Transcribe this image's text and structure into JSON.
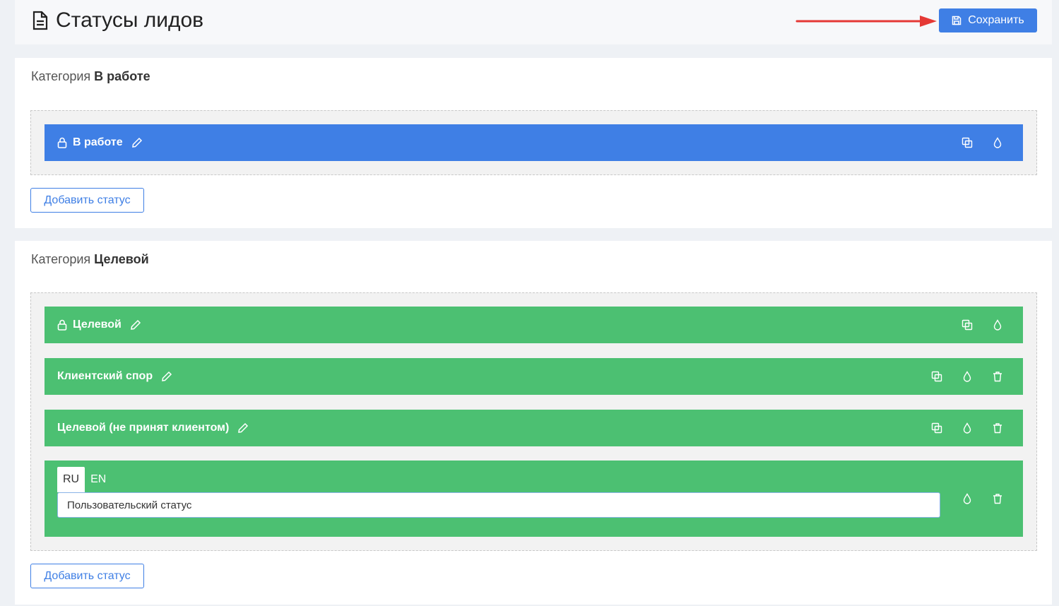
{
  "header": {
    "title": "Статусы лидов",
    "save_label": "Сохранить"
  },
  "categories": [
    {
      "prefix": "Категория",
      "name": "В работе",
      "add_label": "Добавить статус",
      "statuses": [
        {
          "label": "В работе",
          "color": "#3f7fe5",
          "locked": true
        }
      ]
    },
    {
      "prefix": "Категория",
      "name": "Целевой",
      "add_label": "Добавить статус",
      "statuses": [
        {
          "label": "Целевой",
          "color": "#4cc072",
          "locked": true
        },
        {
          "label": "Клиентский спор",
          "color": "#4cc072",
          "locked": false
        },
        {
          "label": "Целевой (не принят клиентом)",
          "color": "#4cc072",
          "locked": false
        }
      ],
      "new_status": {
        "langs": [
          "RU",
          "EN"
        ],
        "active_lang": "RU",
        "value": "Пользовательский статус"
      }
    }
  ],
  "colors": {
    "accent": "#3f7fe5",
    "green": "#4cc072",
    "annotation_arrow": "#e53935"
  },
  "icons": [
    "document-icon",
    "save-icon",
    "lock-icon",
    "pencil-icon",
    "copy-icon",
    "drop-icon",
    "trash-icon"
  ]
}
